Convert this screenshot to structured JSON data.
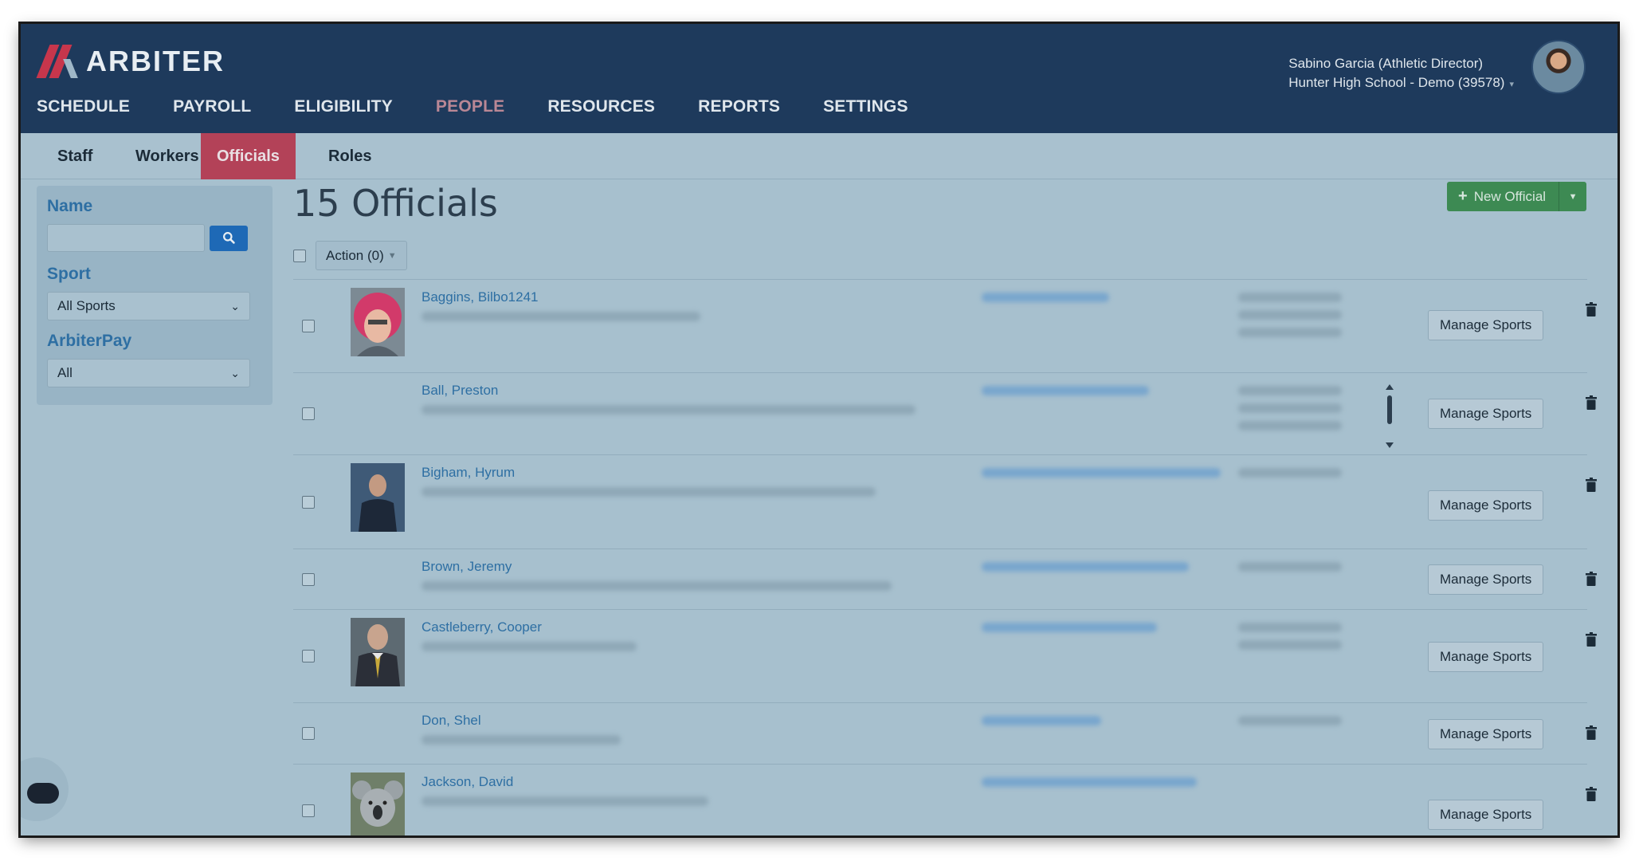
{
  "header": {
    "logo_text": "ARBITER",
    "nav": [
      "SCHEDULE",
      "PAYROLL",
      "ELIGIBILITY",
      "PEOPLE",
      "RESOURCES",
      "REPORTS",
      "SETTINGS"
    ],
    "active_nav": "PEOPLE",
    "user_name": "Sabino Garcia (Athletic Director)",
    "user_school": "Hunter High School - Demo (39578)"
  },
  "subnav": {
    "items": [
      "Staff",
      "Workers",
      "Officials",
      "Roles"
    ],
    "active": "Officials"
  },
  "sidebar": {
    "name_label": "Name",
    "name_value": "",
    "sport_label": "Sport",
    "sport_selected": "All Sports",
    "arbiterpay_label": "ArbiterPay",
    "arbiterpay_selected": "All"
  },
  "main": {
    "title": "15 Officials",
    "new_button": "New Official",
    "action_button": "Action (0)",
    "manage_label": "Manage Sports",
    "rows": [
      {
        "name": "Baggins, Bilbo1241",
        "photo": "red-wig-person"
      },
      {
        "name": "Ball, Preston",
        "photo": ""
      },
      {
        "name": "Bigham, Hyrum",
        "photo": "man-dark-shirt"
      },
      {
        "name": "Brown, Jeremy",
        "photo": ""
      },
      {
        "name": "Castleberry, Cooper",
        "photo": "man-suit"
      },
      {
        "name": "Don, Shel",
        "photo": ""
      },
      {
        "name": "Jackson, David",
        "photo": "koala"
      }
    ]
  },
  "icons": {
    "search": "search-icon",
    "trash": "trash-icon",
    "plus": "plus-icon",
    "chat": "chat-icon"
  },
  "colors": {
    "header_bg": "#1e3a5c",
    "active_tab": "#b34258",
    "link": "#2e6fa3",
    "new_button": "#3d8a53"
  }
}
